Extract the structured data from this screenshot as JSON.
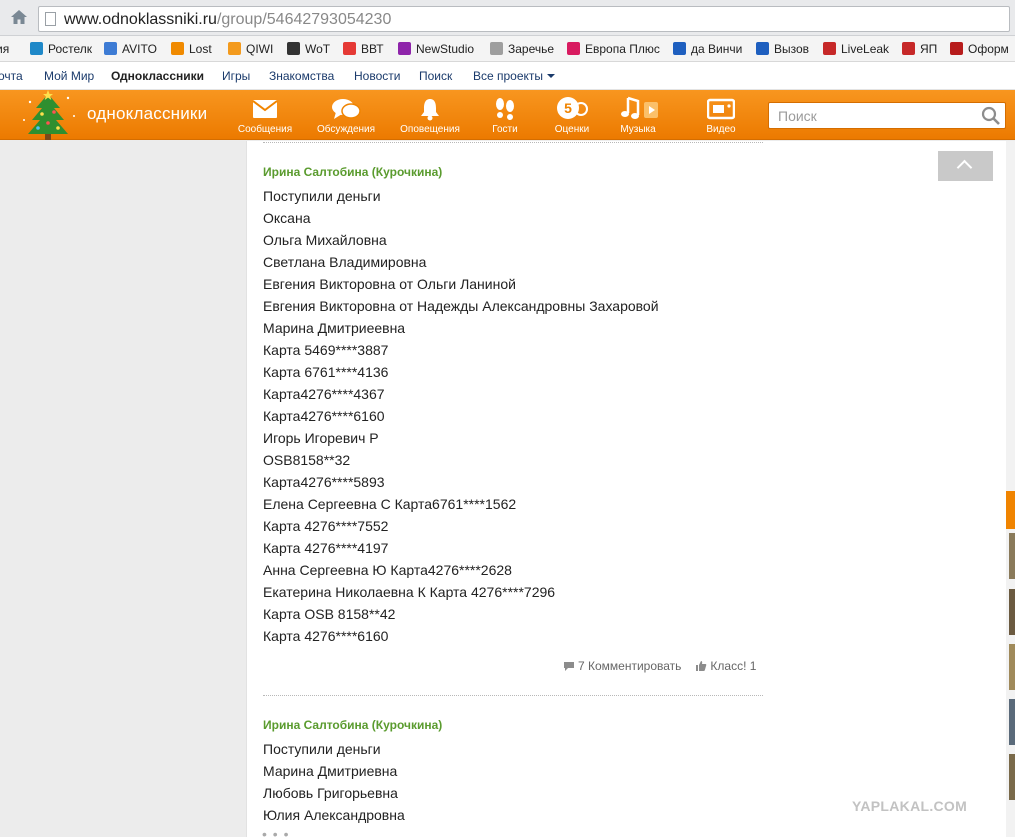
{
  "browser": {
    "url_host": "www.odnoklassniki.ru",
    "url_path": "/group/54642793054230"
  },
  "bookmarks": [
    {
      "label": "ия",
      "icon": "bookmark-icon",
      "color": "#7a7a7a"
    },
    {
      "label": "Ростелк",
      "icon": "rostelecom-icon",
      "color": "#1e88c8"
    },
    {
      "label": "AVITO",
      "icon": "avito-icon",
      "color": "#3d7bd4"
    },
    {
      "label": "Lost",
      "icon": "lf-icon",
      "color": "#f08a00"
    },
    {
      "label": "QIWI",
      "icon": "qiwi-icon",
      "color": "#f39a1d"
    },
    {
      "label": "WoT",
      "icon": "wot-icon",
      "color": "#333333"
    },
    {
      "label": "ВВТ",
      "icon": "vvt-icon",
      "color": "#e53935"
    },
    {
      "label": "NewStudio",
      "icon": "newstudio-icon",
      "color": "#8e24aa"
    },
    {
      "label": "Заречье",
      "icon": "page-icon",
      "color": "#9e9e9e"
    },
    {
      "label": "Европа Плюс",
      "icon": "europa-plus-icon",
      "color": "#d81b60"
    },
    {
      "label": "да Винчи",
      "icon": "butterfly-icon",
      "color": "#1e5fbf"
    },
    {
      "label": "Вызов",
      "icon": "butterfly-icon",
      "color": "#1e5fbf"
    },
    {
      "label": "LiveLeak",
      "icon": "liveleak-icon",
      "color": "#c62828"
    },
    {
      "label": "ЯП",
      "icon": "yap-icon",
      "color": "#c62828"
    },
    {
      "label": "Оформ",
      "icon": "building-icon",
      "color": "#b71c1c"
    }
  ],
  "projects": {
    "items": [
      "очта",
      "Мой Мир",
      "Одноклассники",
      "Игры",
      "Знакомства",
      "Новости",
      "Поиск",
      "Все проекты"
    ]
  },
  "toolbar": {
    "logo": "одноклассники",
    "nav": [
      {
        "label": "Сообщения",
        "icon": "envelope-icon"
      },
      {
        "label": "Обсуждения",
        "icon": "speech-bubbles-icon"
      },
      {
        "label": "Оповещения",
        "icon": "bell-icon"
      },
      {
        "label": "Гости",
        "icon": "footprints-icon"
      },
      {
        "label": "Оценки",
        "icon": "rating-5-icon",
        "badge": "5"
      },
      {
        "label": "Музыка",
        "icon": "music-note-icon"
      },
      {
        "label": "Видео",
        "icon": "video-icon"
      }
    ],
    "search_placeholder": "Поиск"
  },
  "feed": {
    "posts": [
      {
        "author": "Ирина Салтобина (Курочкина)",
        "lines": [
          "Поступили деньги",
          "Оксана",
          "Ольга Михайловна",
          "Светлана Владимировна",
          "Евгения Викторовна от Ольги Ланиной",
          "Евгения Викторовна от Надежды Александровны Захаровой",
          "Марина Дмитриеевна",
          "Карта 5469****3887",
          "Карта 6761****4136",
          "Карта4276****4367",
          "Карта4276****6160",
          "Игорь Игоревич Р",
          "OSB8158**32",
          "Карта4276****5893",
          "Елена Сергеевна С Карта6761****1562",
          "Карта 4276****7552",
          "Карта 4276****4197",
          "Анна Сергеевна Ю Карта4276****2628",
          "Екатерина Николаевна К Карта 4276****7296",
          "Карта OSB 8158**42",
          "Карта 4276****6160"
        ],
        "comments": "7 Комментировать",
        "klass": "Класс! 1"
      },
      {
        "author": "Ирина Салтобина (Курочкина)",
        "lines": [
          "Поступили деньги",
          "Марина Дмитриевна",
          "Любовь Григорьевна",
          "Юлия Александровна"
        ]
      }
    ]
  },
  "watermark": "YAPLAKAL.COM",
  "colors": {
    "toolbar_orange": "#f08400",
    "author_green": "#5a9b2e"
  }
}
